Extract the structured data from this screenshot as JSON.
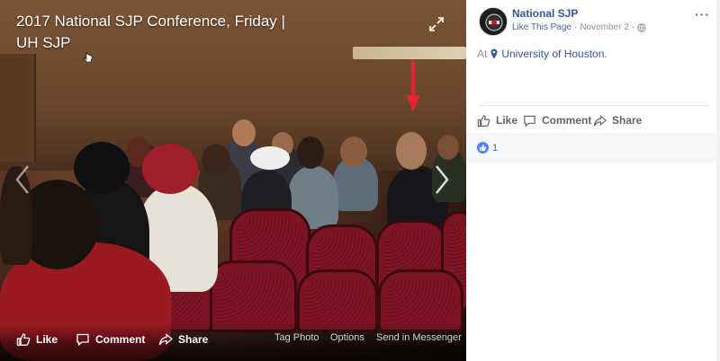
{
  "viewer": {
    "title": "2017 National SJP Conference, Friday | UH SJP",
    "actions": {
      "like": "Like",
      "comment": "Comment",
      "share": "Share"
    },
    "links": {
      "tag_photo": "Tag Photo",
      "options": "Options",
      "send_in_messenger": "Send in Messenger"
    },
    "icons": {
      "expand": "expand-icon",
      "prev": "chevron-left-icon",
      "next": "chevron-right-icon",
      "annotation": "red-arrow"
    }
  },
  "post": {
    "page_name": "National SJP",
    "like_this_page": "Like This Page",
    "separator": "·",
    "date": "November 2",
    "separator2": "·",
    "location_prefix": "At",
    "location": "University of Houston.",
    "actions": {
      "like": "Like",
      "comment": "Comment",
      "share": "Share"
    },
    "reactions": {
      "count": "1"
    },
    "more": "···"
  },
  "colors": {
    "link": "#365899",
    "muted": "#90949c",
    "action": "#606770",
    "like_blue": "#4f87f7",
    "annotation_red": "#e8222e"
  }
}
